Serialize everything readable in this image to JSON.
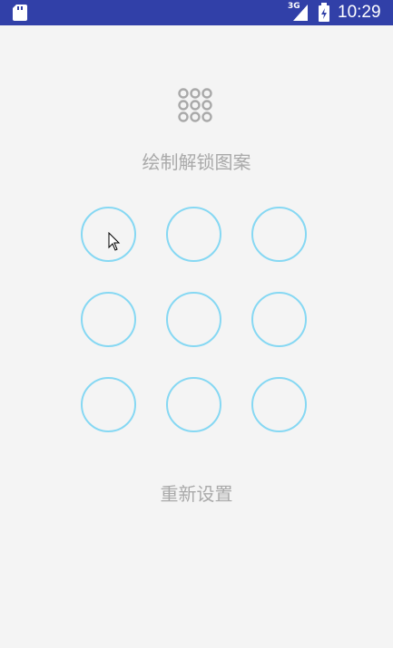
{
  "status_bar": {
    "network": "3G",
    "time": "10:29",
    "icons": [
      "sd-card-icon",
      "signal-icon",
      "battery-icon"
    ]
  },
  "lock": {
    "icon": "pattern-grid-icon",
    "prompt": "绘制解锁图案",
    "reset_label": "重新设置",
    "ring_color": "#86d8f3",
    "text_color": "#a9a9a9"
  },
  "colors": {
    "status_bar": "#3140a8",
    "background": "#f4f4f4"
  }
}
